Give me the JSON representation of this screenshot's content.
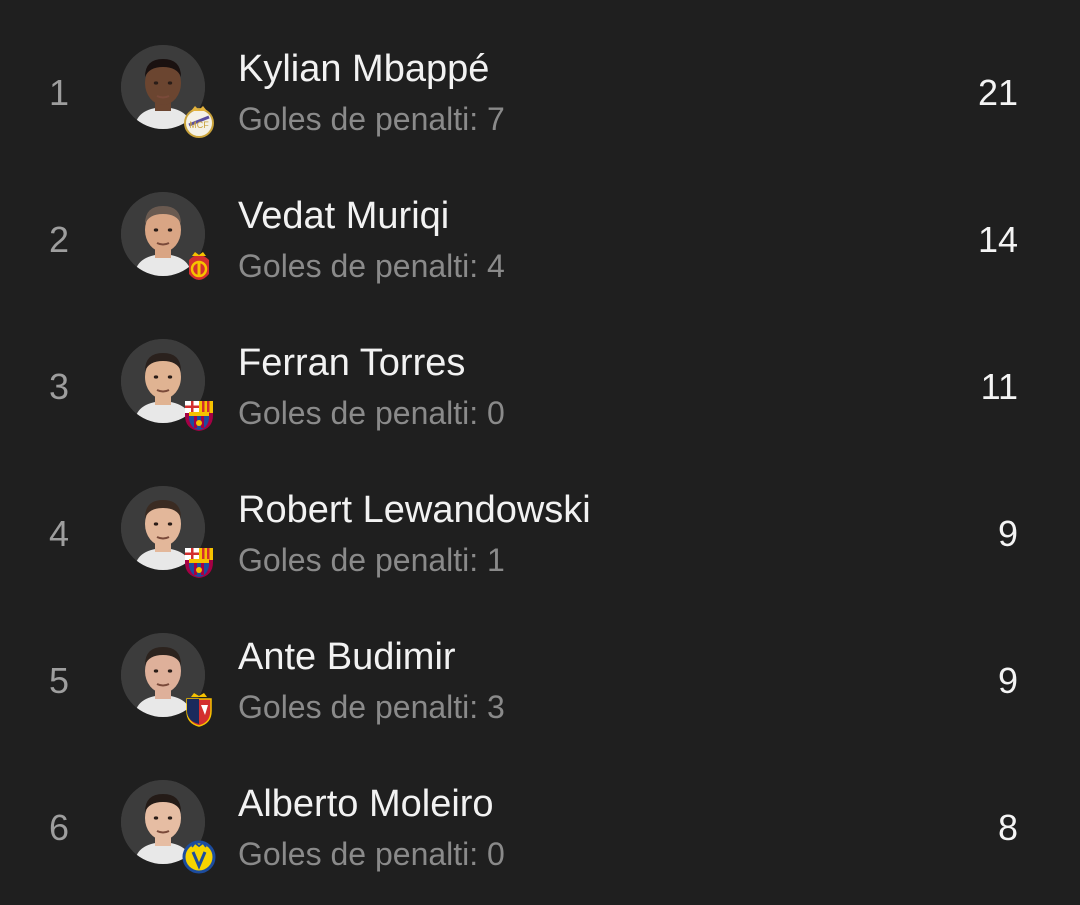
{
  "sub_label": "Goles de penalti:",
  "players": [
    {
      "rank": "1",
      "name": "Kylian Mbappé",
      "penalties": "7",
      "goals": "21",
      "club_icon": "real-madrid-crest-icon",
      "skin": "#6b4530",
      "hair": "#1a1110"
    },
    {
      "rank": "2",
      "name": "Vedat Muriqi",
      "penalties": "4",
      "goals": "14",
      "club_icon": "mallorca-crest-icon",
      "skin": "#d9a584",
      "hair": "#6a5a50"
    },
    {
      "rank": "3",
      "name": "Ferran Torres",
      "penalties": "0",
      "goals": "11",
      "club_icon": "barcelona-crest-icon",
      "skin": "#e0b392",
      "hair": "#2a211d"
    },
    {
      "rank": "4",
      "name": "Robert Lewandowski",
      "penalties": "1",
      "goals": "9",
      "club_icon": "barcelona-crest-icon",
      "skin": "#e3b79a",
      "hair": "#3a2b22"
    },
    {
      "rank": "5",
      "name": "Ante Budimir",
      "penalties": "3",
      "goals": "9",
      "club_icon": "osasuna-crest-icon",
      "skin": "#deb09a",
      "hair": "#2c231e"
    },
    {
      "rank": "6",
      "name": "Alberto Moleiro",
      "penalties": "0",
      "goals": "8",
      "club_icon": "villarreal-crest-icon",
      "skin": "#e6bda3",
      "hair": "#241b17"
    }
  ],
  "colors": {
    "background": "#1f1f1f",
    "name_text": "#f2f2f2",
    "secondary_text": "#8a8a8a",
    "rank_text": "#9e9e9e"
  }
}
